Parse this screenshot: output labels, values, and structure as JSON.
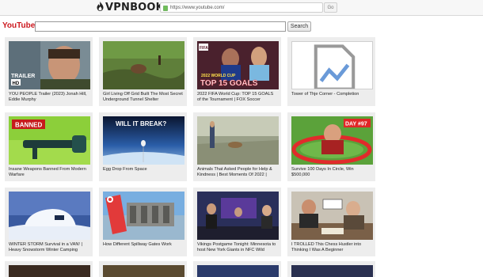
{
  "header": {
    "logo_text": "VPNBOOK",
    "url": "https://www.youtube.com/",
    "go_label": "Go"
  },
  "search": {
    "brand": "YouTube",
    "value": "",
    "placeholder": "",
    "button_label": "Search"
  },
  "videos": [
    {
      "title": "YOU PEOPLE Trailer (2023) Jonah Hill, Eddie Murphy",
      "thumb_text": "TRAILER",
      "thumb_badge": "HD"
    },
    {
      "title": "Girl Living Off Grid Built The Most Secret Underground Tunnel Shelter"
    },
    {
      "title": "2022 FIFA World Cup: TOP 15 GOALS of the Tournament | FOX Soccer",
      "thumb_text": "TOP 15 GOALS",
      "thumb_sub": "2022 WORLD CUP",
      "thumb_badge": "FIFA"
    },
    {
      "title": "Tower of Thje Corner - Completion"
    },
    {
      "title": "Insane Weapons Banned From Modern Warfare",
      "thumb_text": "BANNED"
    },
    {
      "title": "Egg Drop From Space",
      "thumb_text": "WILL IT BREAK?"
    },
    {
      "title": "Animals That Asked People for Help & Kindness | Best Moments Of 2022 |"
    },
    {
      "title": "Survive 100 Days In Circle, Win $500,000",
      "thumb_text": "DAY #97"
    },
    {
      "title": "WINTER STORM Survival in a VAN! | Heavy Snowstorm Winter Camping"
    },
    {
      "title": "How Different Spillway Gates Work"
    },
    {
      "title": "Vikings Postgame Tonight: Minnesota to host New York Giants in NFC Wild"
    },
    {
      "title": "I TROLLED This Chess Hustler into Thinking I Was A Beginner"
    }
  ]
}
